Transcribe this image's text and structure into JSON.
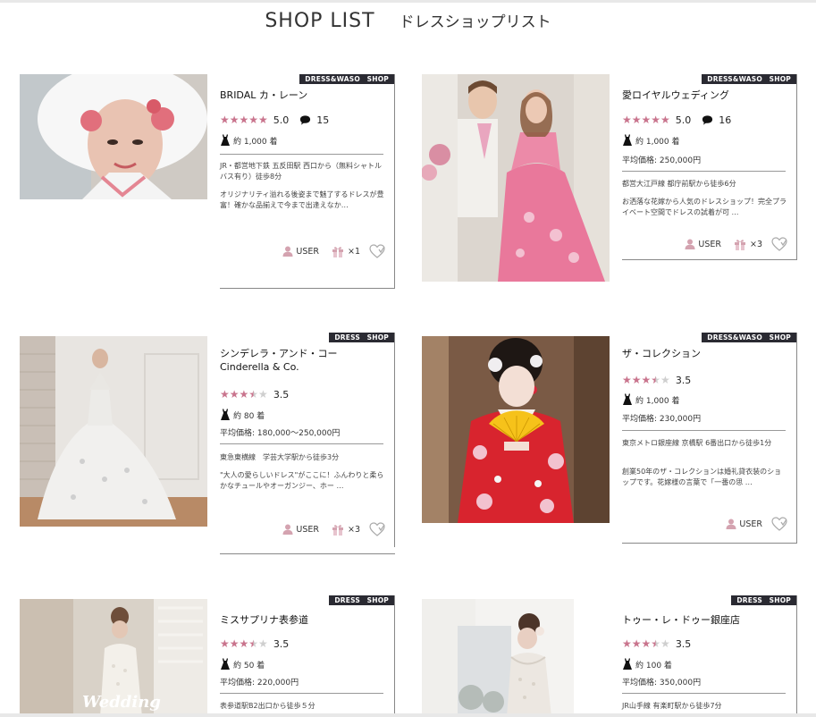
{
  "header": {
    "title_en": "SHOP LIST",
    "title_jp": "ドレスショップリスト"
  },
  "shops": [
    {
      "ribbon": "DRESS&WASO　SHOP",
      "name": "BRIDAL カ・レーン",
      "rating": "5.0",
      "stars_full": 5,
      "stars_half": 0,
      "comments": "15",
      "stock": "約 1,000 着",
      "price": "",
      "access": "JR・都営地下鉄 五反田駅 西口から（無料シャトルバス有り）徒歩8分",
      "desc": "オリジナリティ溢れる後姿まで魅了するドレスが豊富！確かな品揃えで今まで出逢えなか…",
      "user_label": "USER",
      "gift_count": "×1"
    },
    {
      "ribbon": "DRESS&WASO　SHOP",
      "name": "愛ロイヤルウェディング",
      "rating": "5.0",
      "stars_full": 5,
      "stars_half": 0,
      "comments": "16",
      "stock": "約 1,000 着",
      "price": "平均価格: 250,000円",
      "access": "都営大江戸線 都庁前駅から徒歩6分",
      "desc": "お洒落な花嫁から人気のドレスショップ！完全プライベート空間でドレスの試着が可 …",
      "user_label": "USER",
      "gift_count": "×3"
    },
    {
      "ribbon": "DRESS　SHOP",
      "name": "シンデレラ・アンド・コー Cinderella & Co.",
      "rating": "3.5",
      "stars_full": 3,
      "stars_half": 1,
      "comments": "",
      "stock": "約 80 着",
      "price": "平均価格: 180,000〜250,000円",
      "access": "東急東横線　学芸大学駅から徒歩3分",
      "desc": "\"大人の愛らしいドレス\"がここに！ふんわりと柔らかなチュールやオーガンジー、ホー …",
      "user_label": "USER",
      "gift_count": "×3"
    },
    {
      "ribbon": "DRESS&WASO　SHOP",
      "name": "ザ・コレクション",
      "rating": "3.5",
      "stars_full": 3,
      "stars_half": 1,
      "comments": "",
      "stock": "約 1,000 着",
      "price": "平均価格: 230,000円",
      "access": "東京メトロ銀座線 京橋駅 6番出口から徒歩1分",
      "desc": "創業50年のザ・コレクションは婚礼貸衣装のショップです。花嫁様の言葉で「一番の思 …",
      "user_label": "USER",
      "gift_count": ""
    },
    {
      "ribbon": "DRESS　SHOP",
      "name": "ミスサプリナ表参道",
      "rating": "3.5",
      "stars_full": 3,
      "stars_half": 1,
      "comments": "",
      "stock": "約 50 着",
      "price": "平均価格: 220,000円",
      "access": "表参道駅B2出口から徒歩５分",
      "desc": "",
      "photo_text": "Wedding",
      "user_label": "",
      "gift_count": ""
    },
    {
      "ribbon": "DRESS　SHOP",
      "name": "トゥー・レ・ドゥー銀座店",
      "rating": "3.5",
      "stars_full": 3,
      "stars_half": 1,
      "comments": "",
      "stock": "約 100 着",
      "price": "平均価格: 350,000円",
      "access": "JR山手線 有楽町駅から徒歩7分",
      "desc": "",
      "user_label": "",
      "gift_count": ""
    }
  ],
  "icons": {
    "comment": "speech-bubble-icon",
    "stock": "dress-icon",
    "user": "user-icon",
    "gift": "gift-icon",
    "favorite": "heart-icon"
  },
  "colors": {
    "star": "#c9748d",
    "ribbon": "#2a2a32",
    "user_icon": "#d4a3b0"
  }
}
